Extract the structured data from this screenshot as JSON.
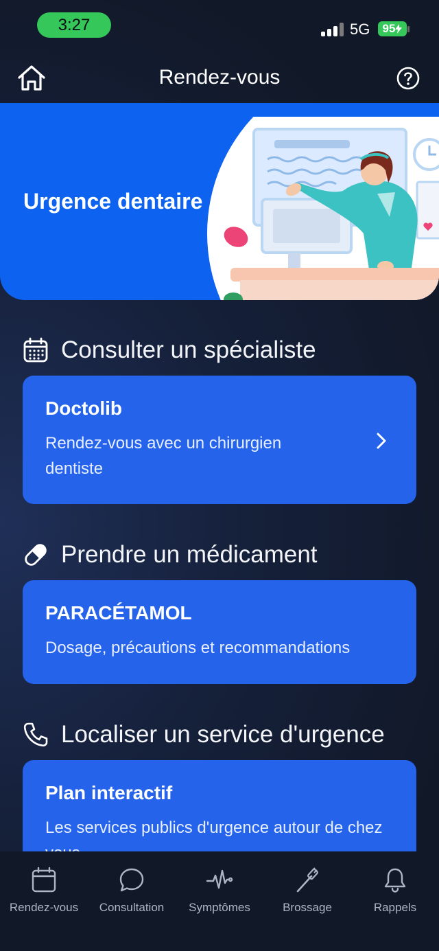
{
  "status_bar": {
    "time": "3:27",
    "network": "5G",
    "battery": "95"
  },
  "header": {
    "title": "Rendez-vous",
    "home_icon": "home-icon",
    "help_icon": "help-circle-icon"
  },
  "hero": {
    "title": "Urgence dentaire"
  },
  "sections": [
    {
      "icon": "calendar-icon",
      "title": "Consulter un spécialiste",
      "card": {
        "title": "Doctolib",
        "description": "Rendez-vous avec un chirurgien dentiste"
      }
    },
    {
      "icon": "pill-icon",
      "title": "Prendre un médicament",
      "card": {
        "title": "PARACÉTAMOL",
        "description": "Dosage, précautions et recommandations"
      }
    },
    {
      "icon": "phone-icon",
      "title": "Localiser un service d'urgence",
      "card": {
        "title": "Plan interactif",
        "description": "Les services publics d'urgence autour de chez vous"
      }
    }
  ],
  "tabs": [
    {
      "label": "Rendez-vous",
      "icon": "calendar-icon"
    },
    {
      "label": "Consultation",
      "icon": "chat-bubble-icon"
    },
    {
      "label": "Symptômes",
      "icon": "heartbeat-icon"
    },
    {
      "label": "Brossage",
      "icon": "toothbrush-icon"
    },
    {
      "label": "Rappels",
      "icon": "bell-icon"
    }
  ],
  "colors": {
    "accent": "#2563eb",
    "hero": "#0d63f0",
    "status_green": "#35c759"
  }
}
